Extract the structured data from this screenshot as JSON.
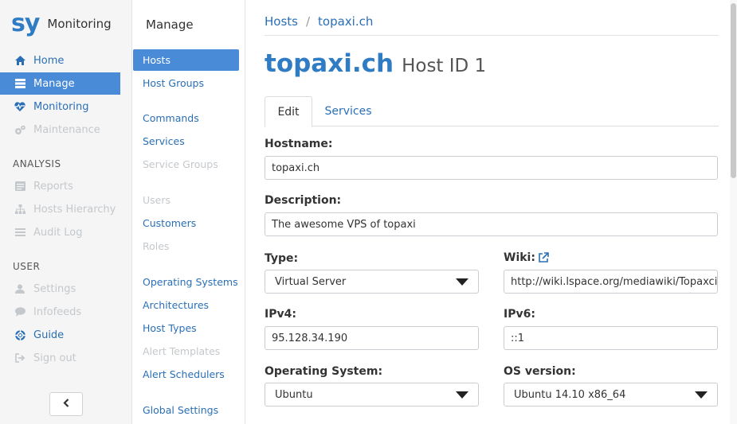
{
  "brand": {
    "logo": "sy",
    "app_name": "Monitoring"
  },
  "sidebar": {
    "items": [
      {
        "label": "Home",
        "icon": "home-icon"
      },
      {
        "label": "Manage",
        "icon": "server-icon"
      },
      {
        "label": "Monitoring",
        "icon": "heartbeat-icon"
      },
      {
        "label": "Maintenance",
        "icon": "cogs-icon"
      }
    ],
    "analysis_header": "ANALYSIS",
    "analysis_items": [
      {
        "label": "Reports",
        "icon": "report-icon"
      },
      {
        "label": "Hosts Hierarchy",
        "icon": "sitemap-icon"
      },
      {
        "label": "Audit Log",
        "icon": "list-icon"
      }
    ],
    "user_header": "USER",
    "user_items": [
      {
        "label": "Settings",
        "icon": "user-icon"
      },
      {
        "label": "Infofeeds",
        "icon": "comment-icon"
      },
      {
        "label": "Guide",
        "icon": "lifebuoy-icon"
      },
      {
        "label": "Sign out",
        "icon": "sign-out-icon"
      }
    ],
    "collapse_icon": "chevron-left-icon"
  },
  "manage": {
    "title": "Manage",
    "items": [
      "Hosts",
      "Host Groups",
      "Commands",
      "Services",
      "Service Groups",
      "Users",
      "Customers",
      "Roles",
      "Operating Systems",
      "Architectures",
      "Host Types",
      "Alert Templates",
      "Alert Schedulers",
      "Global Settings"
    ]
  },
  "breadcrumb": {
    "root": "Hosts",
    "separator": "/",
    "current": "topaxi.ch"
  },
  "page": {
    "title": "topaxi.ch",
    "subtitle": "Host ID 1"
  },
  "tabs": {
    "edit": "Edit",
    "services": "Services"
  },
  "form": {
    "hostname_label": "Hostname:",
    "hostname_value": "topaxi.ch",
    "description_label": "Description:",
    "description_value": "The awesome VPS of topaxi",
    "type_label": "Type:",
    "type_value": "Virtual Server",
    "wiki_label": "Wiki:",
    "wiki_value": "http://wiki.lspace.org/mediawiki/Topaxci",
    "ipv4_label": "IPv4:",
    "ipv4_value": "95.128.34.190",
    "ipv6_label": "IPv6:",
    "ipv6_value": "::1",
    "os_label": "Operating System:",
    "os_value": "Ubuntu",
    "osver_label": "OS version:",
    "osver_value": "Ubuntu 14.10 x86_64"
  },
  "colors": {
    "accent": "#2f7cc4",
    "active_bg": "#4a8bd8",
    "disabled": "#c4c8cc"
  }
}
